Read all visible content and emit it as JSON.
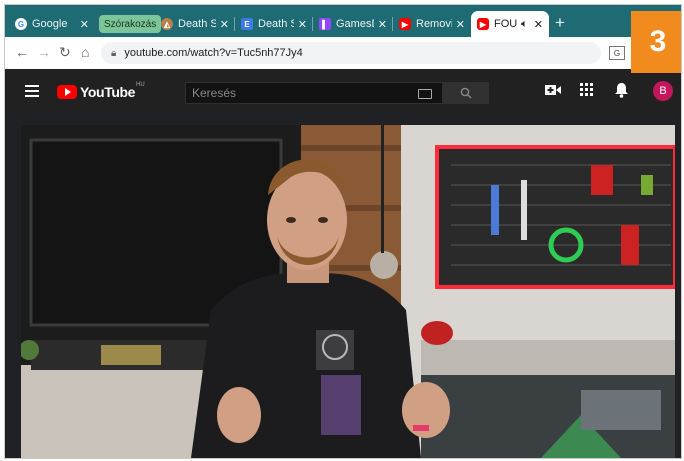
{
  "tabs": [
    {
      "title": "Google",
      "favicon": "google-icon",
      "color": "#ffffff"
    },
    {
      "title": "Death S",
      "favicon": "death-stranding-icon",
      "color": "#b9804a"
    },
    {
      "title": "Death S",
      "favicon": "document-e-icon",
      "color": "#3c7be6"
    },
    {
      "title": "GamesD",
      "favicon": "twitch-icon",
      "color": "#9146ff"
    },
    {
      "title": "Removi",
      "favicon": "youtube-icon",
      "color": "#ff0000"
    },
    {
      "title": "FOU",
      "favicon": "youtube-icon",
      "color": "#ff0000"
    }
  ],
  "tab_group_label": "Szórakozás",
  "badge_number": "3",
  "address_url": "youtube.com/watch?v=Tuc5nh77Jy4",
  "youtube": {
    "logo_text": "YouTube",
    "region": "HU",
    "search_placeholder": "Keresés",
    "avatar_letter": "B"
  }
}
